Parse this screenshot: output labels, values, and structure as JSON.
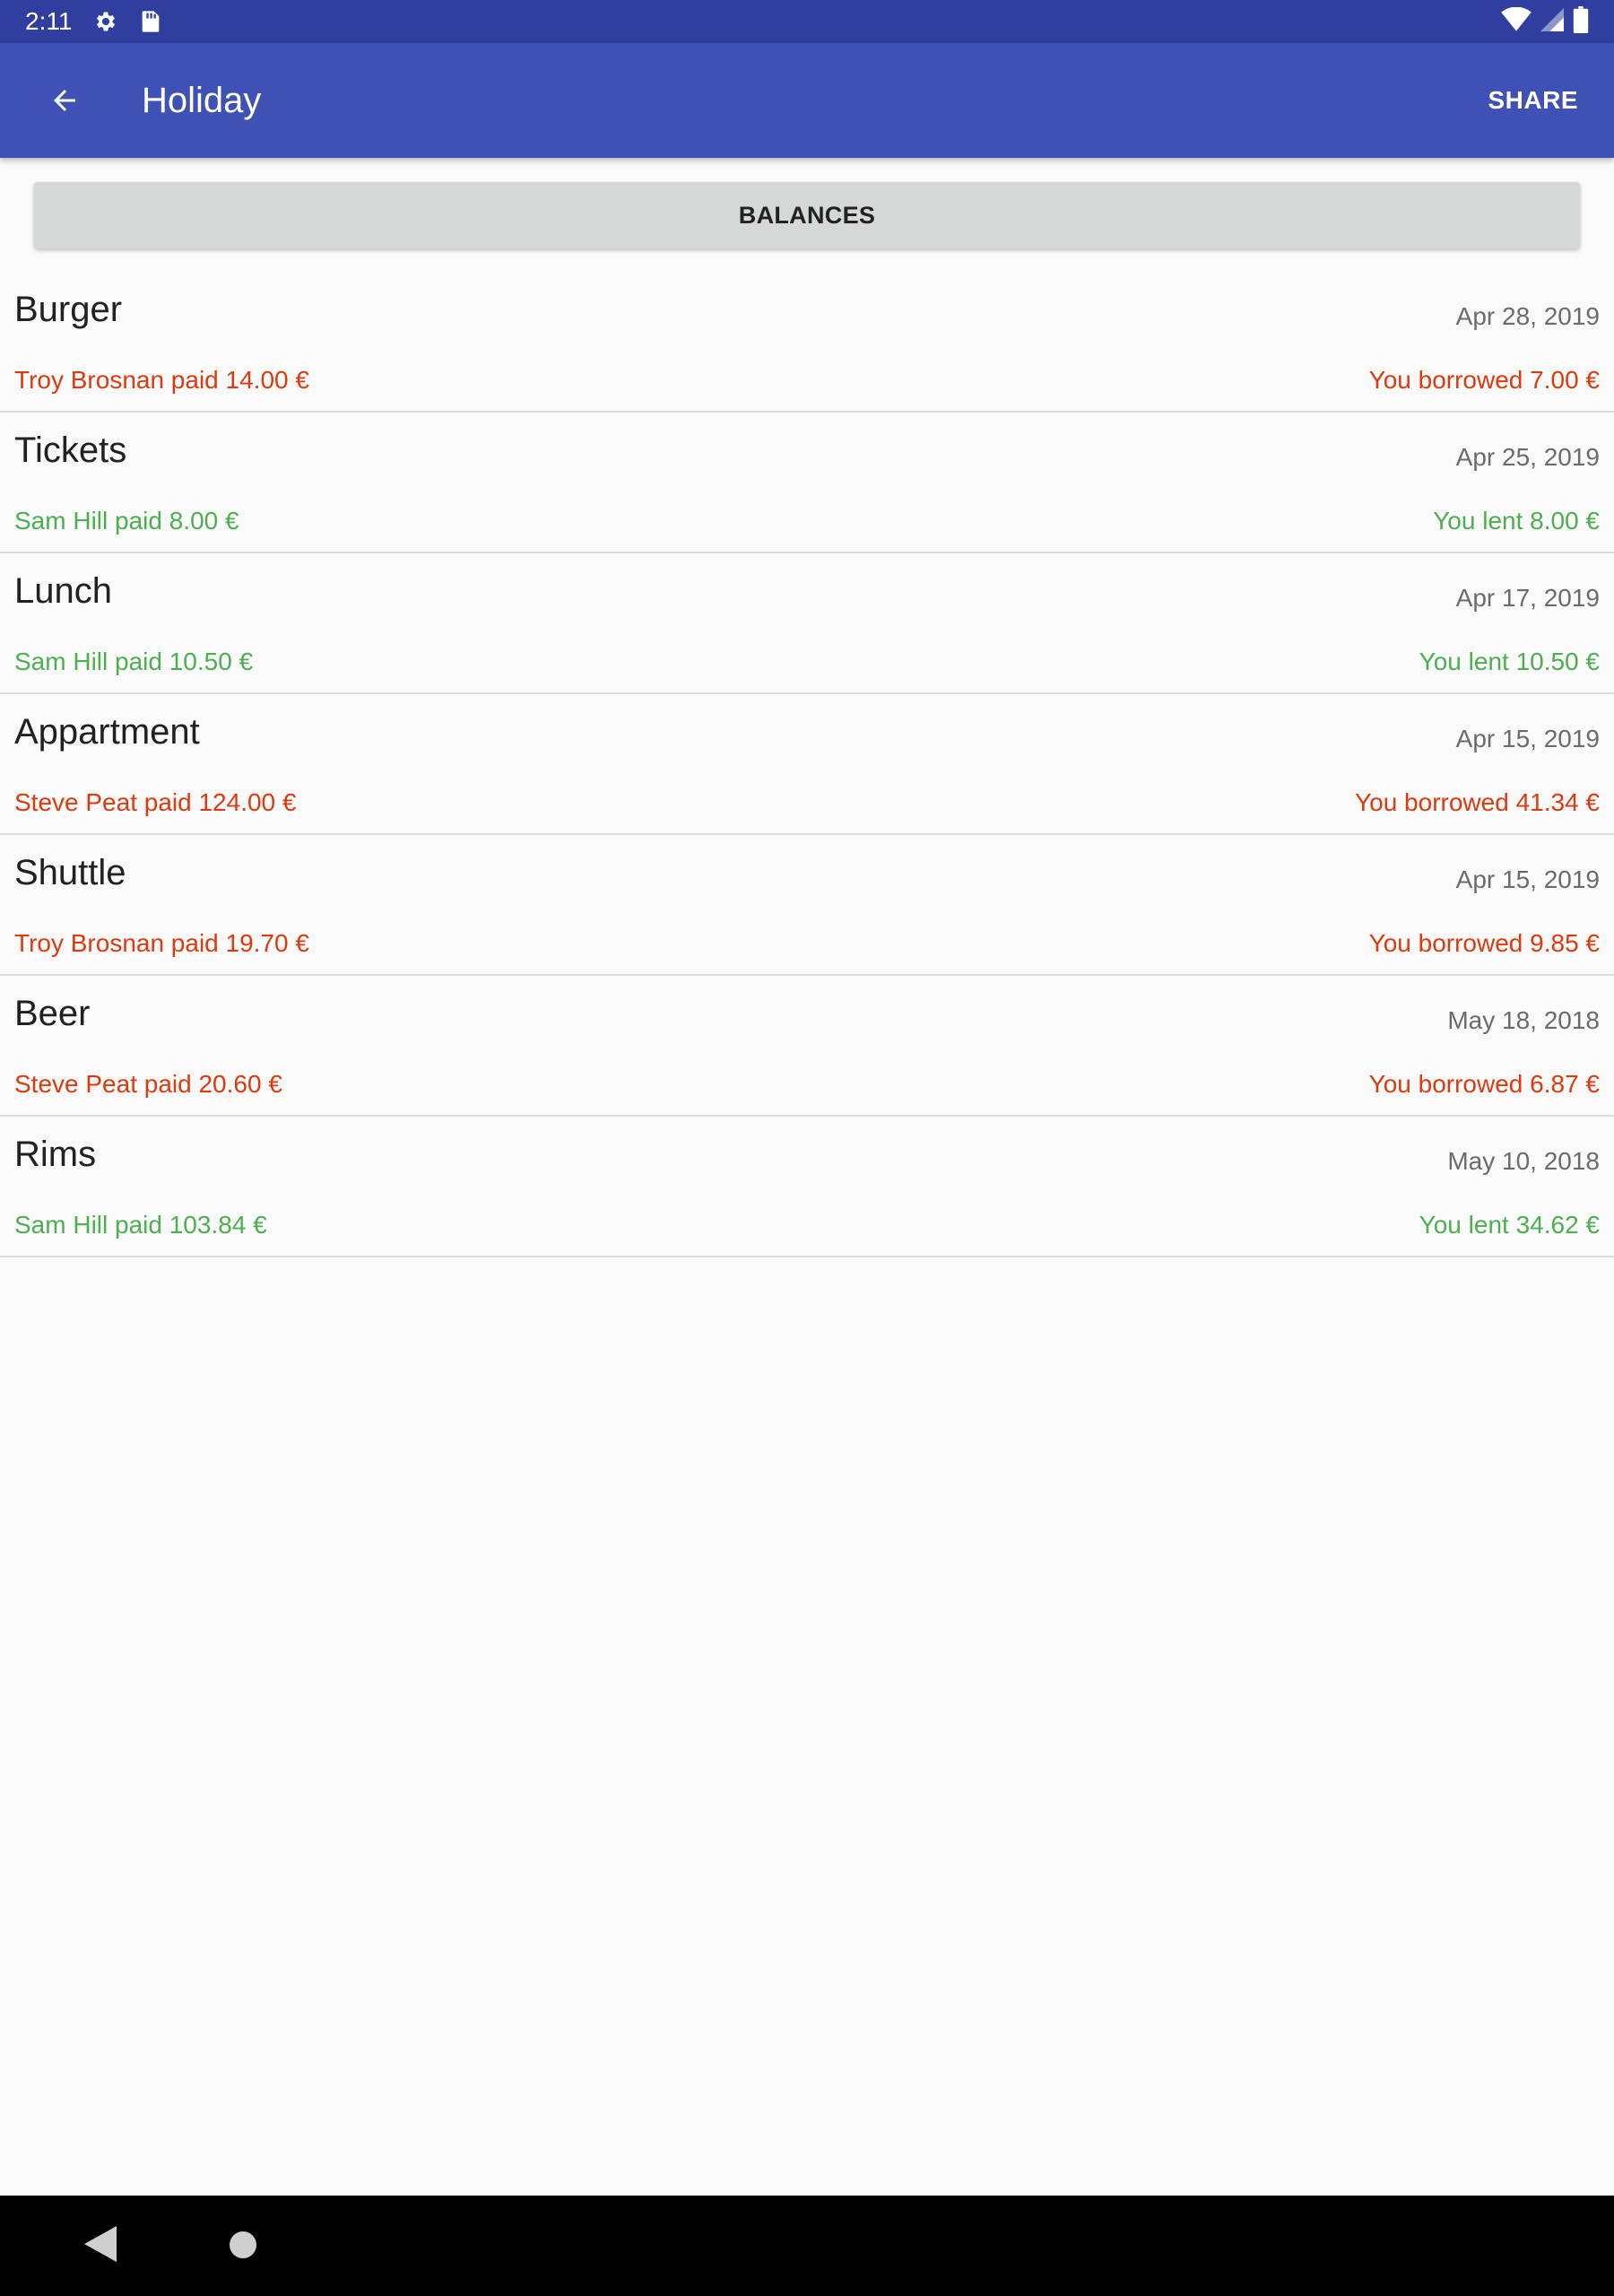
{
  "status_bar": {
    "time": "2:11",
    "icons_left": [
      "settings-icon",
      "sd-card-icon"
    ],
    "icons_right": [
      "wifi-icon",
      "cell-signal-icon",
      "battery-icon"
    ]
  },
  "app_bar": {
    "title": "Holiday",
    "share_label": "SHARE",
    "color": "#3f51b5"
  },
  "balances_label": "BALANCES",
  "colors": {
    "borrowed": "#dd3a0e",
    "lent": "#4caf50"
  },
  "expenses": [
    {
      "title": "Burger",
      "date": "Apr 28, 2019",
      "paid": "Troy Brosnan paid 14.00 €",
      "balance": "You borrowed 7.00 €",
      "type": "borrowed"
    },
    {
      "title": "Tickets",
      "date": "Apr 25, 2019",
      "paid": "Sam Hill paid 8.00 €",
      "balance": "You lent 8.00 €",
      "type": "lent"
    },
    {
      "title": "Lunch",
      "date": "Apr 17, 2019",
      "paid": "Sam Hill paid 10.50 €",
      "balance": "You lent 10.50 €",
      "type": "lent"
    },
    {
      "title": "Appartment",
      "date": "Apr 15, 2019",
      "paid": "Steve Peat paid 124.00 €",
      "balance": "You borrowed 41.34 €",
      "type": "borrowed"
    },
    {
      "title": "Shuttle",
      "date": "Apr 15, 2019",
      "paid": "Troy Brosnan paid 19.70 €",
      "balance": "You borrowed 9.85 €",
      "type": "borrowed"
    },
    {
      "title": "Beer",
      "date": "May 18, 2018",
      "paid": "Steve Peat paid 20.60 €",
      "balance": "You borrowed 6.87 €",
      "type": "borrowed"
    },
    {
      "title": "Rims",
      "date": "May 10, 2018",
      "paid": "Sam Hill paid 103.84 €",
      "balance": "You lent 34.62 €",
      "type": "lent"
    }
  ],
  "nav_bar": {
    "buttons": [
      "back-triangle-icon",
      "home-circle-icon"
    ]
  }
}
